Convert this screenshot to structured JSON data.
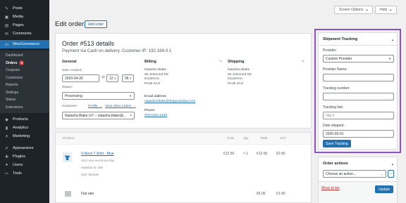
{
  "sidebar": {
    "items_top": [
      {
        "label": "Posts",
        "icon": "pin-icon",
        "glyph": "✎"
      },
      {
        "label": "Media",
        "icon": "media-icon",
        "glyph": "▣"
      },
      {
        "label": "Pages",
        "icon": "pages-icon",
        "glyph": "▤"
      },
      {
        "label": "Comments",
        "icon": "comments-icon",
        "glyph": "✉"
      }
    ],
    "woocommerce_label": "WooCommerce",
    "woocommerce_glyph": "▭",
    "sub_items": [
      "Dashboard",
      "Orders",
      "Coupons",
      "Customers",
      "Reports",
      "Settings",
      "Status",
      "Extensions"
    ],
    "orders_badge": "5",
    "items_bottom": [
      {
        "label": "Products",
        "icon": "products-icon",
        "glyph": "◆"
      },
      {
        "label": "Analytics",
        "icon": "analytics-icon",
        "glyph": "▮"
      },
      {
        "label": "Marketing",
        "icon": "marketing-icon",
        "glyph": "✈"
      },
      {
        "label": "Appearance",
        "icon": "appearance-icon",
        "glyph": "✐"
      },
      {
        "label": "Plugins",
        "icon": "plugins-icon",
        "glyph": "✚"
      },
      {
        "label": "Users",
        "icon": "users-icon",
        "glyph": "●"
      },
      {
        "label": "Tools",
        "icon": "tools-icon",
        "glyph": "✂"
      }
    ]
  },
  "topbar": {
    "screen_options": "Screen Options",
    "help": "Help"
  },
  "header": {
    "title": "Edit order",
    "add_order": "Add order"
  },
  "order": {
    "heading": "Order #513 details",
    "meta": "Payment via Cash on delivery. Customer IP: 192.168.0.1",
    "general": {
      "title": "General",
      "date_created_label": "Date created:",
      "date": "2020-04-30",
      "at": "@",
      "hour": "12",
      "minute": "06",
      "status_label": "Status:",
      "status": "Processing",
      "customer_label": "Customer:",
      "profile_link": "Profile →",
      "other_orders_link": "View other orders →",
      "customer_value": "Natasha Blake (#7 – natasha.blake@..."
    },
    "billing": {
      "title": "Billing",
      "address": [
        "Natasha Blake",
        "55 Jesmond Rd",
        "KILMAHA",
        "PA35 3AG"
      ],
      "email_label": "Email address:",
      "email": "natasha.blake@shipyouridea.com",
      "phone_label": "Phone:",
      "phone": "078 1234 1234"
    },
    "shipping": {
      "title": "Shipping",
      "address": [
        "Natasha Blake",
        "55 Jesmond Rd",
        "KILMAHA",
        "PA35 3AG"
      ]
    }
  },
  "items": {
    "headers": {
      "product": "Product",
      "cost": "Cost",
      "qty": "Qty",
      "total": "Total",
      "vat": "VAT"
    },
    "rows": [
      {
        "name": "V-Neck T-Shirt - Blue",
        "sku": "SKU: woo-vneck-tee-blue",
        "variation": "Variation ID: 259",
        "size": "Size: Medium",
        "cost": "€12.50",
        "qty": "× 1",
        "total": "€12.50",
        "vat": "€2.50"
      }
    ],
    "shipping_row": {
      "name": "Flat rate",
      "total": "€5.00",
      "vat": "€1.00"
    }
  },
  "tracking": {
    "title": "Shipment Tracking",
    "provider_label": "Provider:",
    "provider": "Custom Provider",
    "provider_name_label": "Provider Name:",
    "provider_name": "",
    "tracking_number_label": "Tracking number:",
    "tracking_number": "",
    "tracking_link_label": "Tracking link:",
    "tracking_link_placeholder": "http://",
    "date_shipped_label": "Date shipped:",
    "date_shipped": "2020-05-01",
    "save": "Save Tracking"
  },
  "actions": {
    "title": "Order actions",
    "select": "Choose an action...",
    "go": "›",
    "move_to_bin": "Move to bin",
    "update": "Update"
  },
  "colors": {
    "accent": "#2271b1",
    "highlight": "#8d52c9",
    "sidebar": "#1d2327",
    "danger": "#b32d2e"
  }
}
